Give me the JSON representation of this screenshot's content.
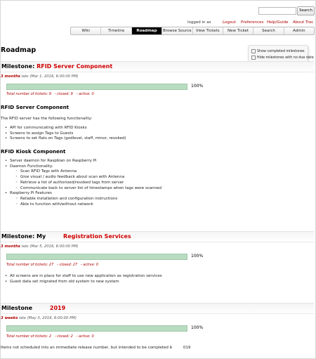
{
  "search": {
    "button_label": "Search"
  },
  "metanav": {
    "logged_in": "logged in as",
    "links": [
      "Logout",
      "Preferences",
      "Help/Guide",
      "About Trac"
    ]
  },
  "mainnav": {
    "tabs": [
      "Wiki",
      "Timeline",
      "Roadmap",
      "Browse Source",
      "View Tickets",
      "New Ticket",
      "Search",
      "Admin"
    ],
    "active": "Roadmap"
  },
  "page": {
    "title": "Roadmap"
  },
  "options": {
    "show_completed": "Show completed milestones",
    "hide_no_due": "Hide milestones with no due date",
    "update_label": "Update"
  },
  "milestones": [
    {
      "prefix": "Milestone:",
      "name": "RFID Server Component",
      "late_strong": "3 months",
      "late_rest": "late (Mar 1, 2016, 6:00:00 PM)",
      "percent": "100%",
      "progress": 1.0,
      "total": "Total number of tickets: 9",
      "closed": "- closed: 9",
      "active": "- active: 0"
    },
    {
      "prefix": "Milestone: My",
      "name": "Registration Services",
      "late_strong": "3 months",
      "late_rest": "late (Mar 5, 2016, 6:00:00 PM)",
      "percent": "100%",
      "progress": 1.0,
      "total": "Total number of tickets: 27",
      "closed": "- closed: 27",
      "active": "- active: 0"
    },
    {
      "prefix": "Milestone",
      "name": "2019",
      "late_strong": "3 weeks",
      "late_rest": "late (May 3, 2016, 6:00:00 PM)",
      "percent": "100%",
      "progress": 1.0,
      "total": "Total number of tickets: 2",
      "closed": "- closed: 2",
      "active": "- active: 0"
    }
  ],
  "m1": {
    "server_title": "RFID Server Component",
    "server_intro": "The RFID server has the following functionality:",
    "server_items": [
      "API for communicating with RFID Kiosks",
      "Screens to assign Tags to Guests",
      "Screens to set flats on Tags (godlevel, staff, minor, revoked)"
    ],
    "kiosk_title": "RFID Kiosk Component",
    "kiosk_item1": "Server daemon for Raspbian on Raspberry Pi",
    "kiosk_item2": "Daemon Functionality:",
    "kiosk_sub1": [
      "Scan RFID Tags with Antenna",
      "Give visual / audio feedback about scan with Antenna",
      "Retrieve a list of authorized/revoked tags from server",
      "Communicate back to server list of timestamps when tags were scanned"
    ],
    "kiosk_item3": "Raspberry Pi Features",
    "kiosk_sub2": [
      "Reliable installation and configuration instructions",
      "Able to function with/without network"
    ]
  },
  "m2": {
    "items": [
      "All screens are in place for staff to use new application as registration services",
      "Guest data set migrated from old system to new system"
    ]
  },
  "m3": {
    "note": "Items not scheduled into an immediate release number, but intended to be completed b",
    "note_tail": "019"
  }
}
